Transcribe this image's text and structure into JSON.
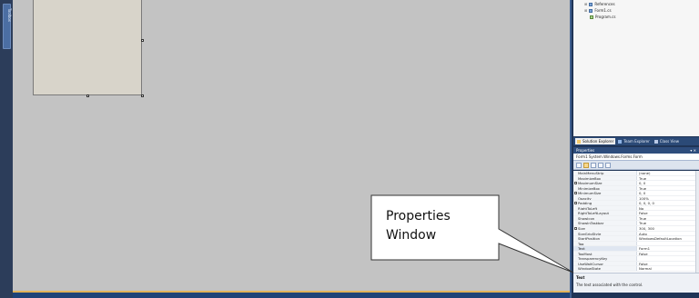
{
  "toolbox": {
    "label": "Toolbox"
  },
  "solution_tree": {
    "items": [
      {
        "label": "References"
      },
      {
        "label": "Form1.cs"
      },
      {
        "label": "Program.cs"
      }
    ]
  },
  "panel_tabs": [
    {
      "label": "Solution Explorer"
    },
    {
      "label": "Team Explorer"
    },
    {
      "label": "Class View"
    }
  ],
  "properties": {
    "title": "Properties",
    "title_buttons": "▾ ✕",
    "selector": "Form1  System.Windows.Forms.Form",
    "rows": [
      {
        "name": "MainMenuStrip",
        "value": "(none)"
      },
      {
        "name": "MaximizeBox",
        "value": "True"
      },
      {
        "name": "MaximumSize",
        "value": "0, 0"
      },
      {
        "name": "MinimizeBox",
        "value": "True"
      },
      {
        "name": "MinimumSize",
        "value": "0, 0"
      },
      {
        "name": "Opacity",
        "value": "100%"
      },
      {
        "name": "Padding",
        "value": "0, 0, 0, 0"
      },
      {
        "name": "RightToLeft",
        "value": "No"
      },
      {
        "name": "RightToLeftLayout",
        "value": "False"
      },
      {
        "name": "ShowIcon",
        "value": "True"
      },
      {
        "name": "ShowInTaskbar",
        "value": "True"
      },
      {
        "name": "Size",
        "value": "300, 300"
      },
      {
        "name": "SizeGripStyle",
        "value": "Auto"
      },
      {
        "name": "StartPosition",
        "value": "WindowsDefaultLocation"
      },
      {
        "name": "Tag",
        "value": ""
      },
      {
        "name": "Text",
        "value": "Form1"
      },
      {
        "name": "TopMost",
        "value": "False"
      },
      {
        "name": "TransparencyKey",
        "value": ""
      },
      {
        "name": "UseWaitCursor",
        "value": "False"
      },
      {
        "name": "WindowState",
        "value": "Normal"
      }
    ],
    "description_title": "Text",
    "description_text": "The text associated with the control."
  },
  "callout": {
    "line1": "Properties",
    "line2": "Window"
  },
  "colors": {
    "ide_dark": "#1f3456",
    "design_bg": "#c3c3c3",
    "form_bg": "#d8d4ca",
    "accent_orange": "#e2b35a"
  }
}
